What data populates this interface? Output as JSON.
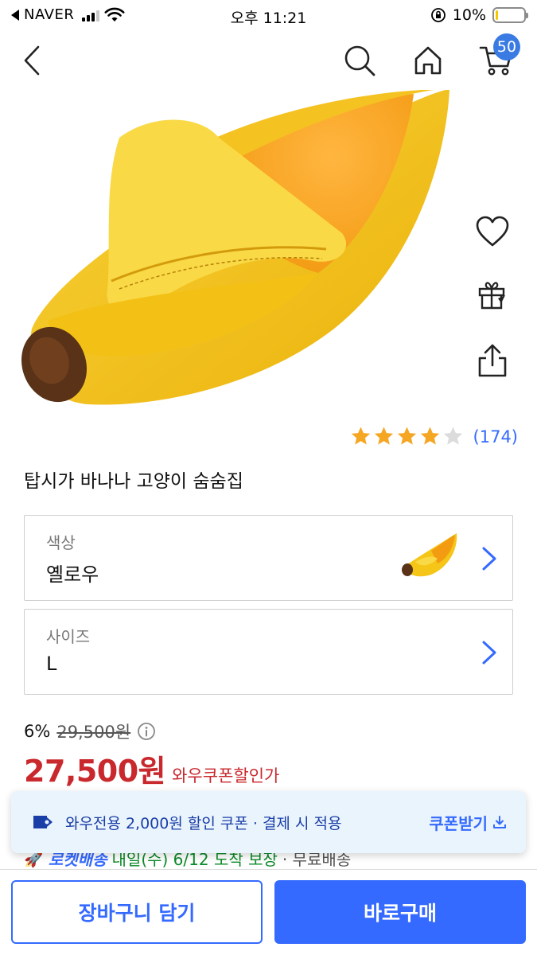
{
  "status_bar": {
    "carrier": "NAVER",
    "time": "오후 11:21",
    "battery": "10%",
    "battery_level": 0.1,
    "battery_color": "#f7c800"
  },
  "nav": {
    "back_icon": "chevron-left-icon",
    "search_icon": "search-icon",
    "home_icon": "home-icon",
    "cart_icon": "cart-icon",
    "cart_count": "50"
  },
  "product": {
    "image_subject": "banana-shaped-pet-bed",
    "rating": 4,
    "rating_max": 5,
    "review_count": "(174)",
    "title": "탑시가 바나나 고양이 숨숨집"
  },
  "side_actions": [
    "heart-icon",
    "gift-icon",
    "share-icon"
  ],
  "options": {
    "color": {
      "label": "색상",
      "value": "옐로우"
    },
    "size": {
      "label": "사이즈",
      "value": "L"
    }
  },
  "price": {
    "discount_rate": "6%",
    "original": "29,500원",
    "sale": "27,500원",
    "sale_label": "와우쿠폰할인가"
  },
  "delivery": {
    "badge": "로켓배송",
    "date": "내일(수) 6/12 도착 보장",
    "shipping": "· 무료배송"
  },
  "coupon": {
    "text": "와우전용 2,000원 할인 쿠폰 · 결제 시 적용",
    "action": "쿠폰받기"
  },
  "actions": {
    "cart": "장바구니 담기",
    "buy": "바로구매"
  },
  "colors": {
    "accent": "#346aff",
    "price_red": "#c9282d",
    "badge_blue": "#3a7be3",
    "star": "#f5a623",
    "star_empty": "#dcdcdc"
  }
}
